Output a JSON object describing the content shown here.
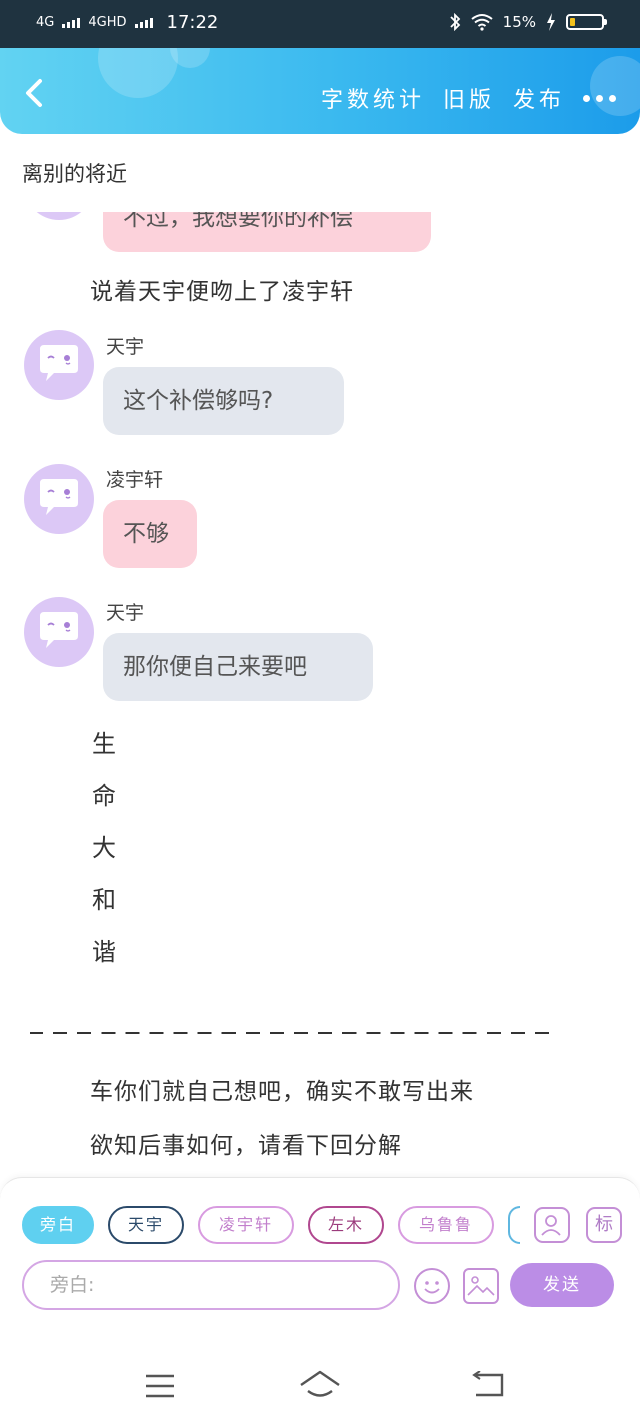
{
  "status_bar": {
    "network_1": "4G",
    "network_2": "4GHD",
    "time": "17:22",
    "battery_percent": "15%",
    "battery_level": 0.15
  },
  "header": {
    "back_icon": "chevron-left-icon",
    "actions": [
      "字数统计",
      "旧版",
      "发布"
    ],
    "more_icon": "more-dots-icon",
    "gradient": [
      "#62d3f2",
      "#1c9cea"
    ]
  },
  "doc": {
    "title": "离别的将近"
  },
  "chat": {
    "partial_bubble_text": "不过，我想要你的补偿",
    "narration_1": "说着天宇便吻上了凌宇轩",
    "messages": [
      {
        "speaker": "天宇",
        "text": "这个补偿够吗?",
        "style": "gray"
      },
      {
        "speaker": "凌宇轩",
        "text": "不够",
        "style": "pink"
      },
      {
        "speaker": "天宇",
        "text": "那你便自己来要吧",
        "style": "gray"
      }
    ],
    "vertical_chars": [
      "生",
      "命",
      "大",
      "和",
      "谐"
    ],
    "narration_2": "车你们就自己想吧，确实不敢写出来",
    "narration_3": "欲知后事如何，请看下回分解"
  },
  "composer": {
    "chips": [
      "旁白",
      "天宇",
      "凌宇轩",
      "左木",
      "乌鲁鲁"
    ],
    "icon_person": "person-icon",
    "icon_tag_label": "标",
    "input_placeholder": "旁白:",
    "emoji_icon": "emoji-icon",
    "image_icon": "image-icon",
    "send_label": "发送"
  },
  "system_nav": {
    "icons": [
      "menu-icon",
      "home-icon",
      "back-icon"
    ]
  }
}
